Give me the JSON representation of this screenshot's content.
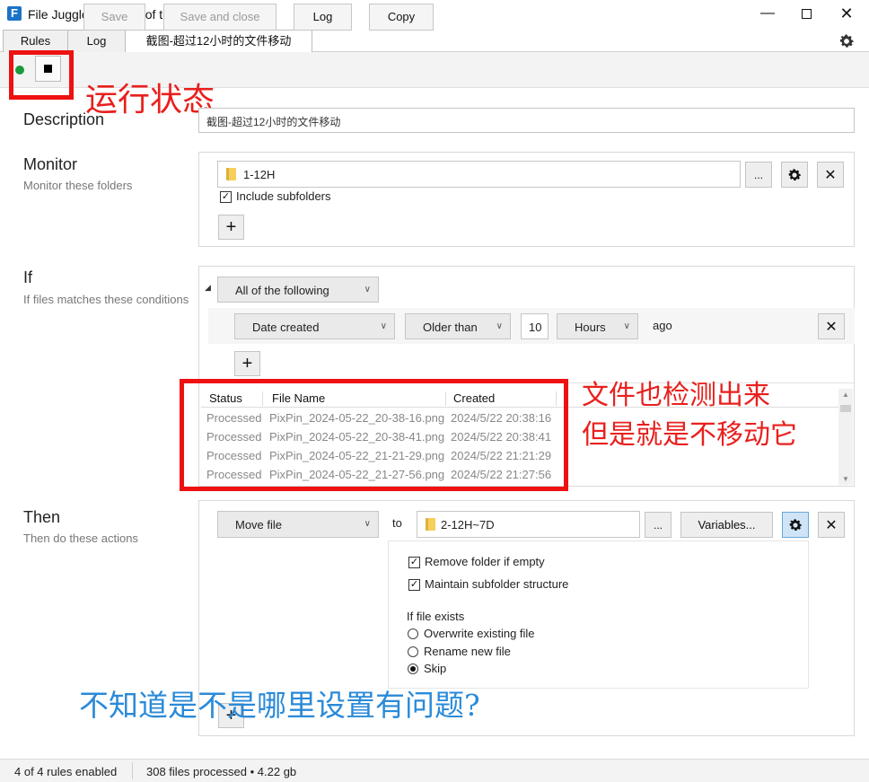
{
  "window": {
    "title": "File Juggler - day 38 of trial period",
    "icon_letter": "F"
  },
  "tabs": [
    {
      "label": "Rules"
    },
    {
      "label": "Log"
    },
    {
      "label": "截图-超过12小时的文件移动"
    }
  ],
  "toolbar": {
    "save": "Save",
    "save_close": "Save and close",
    "log": "Log",
    "copy": "Copy"
  },
  "description": {
    "title": "Description",
    "value": "截图-超过12小时的文件移动"
  },
  "monitor": {
    "title": "Monitor",
    "subtitle": "Monitor these folders",
    "folder": "1-12H",
    "browse": "...",
    "include_subfolders": "Include subfolders",
    "include_checked": true
  },
  "conditions": {
    "title": "If",
    "subtitle": "If files matches these conditions",
    "mode": "All of the following",
    "field": "Date created",
    "operator": "Older than",
    "amount": "10",
    "unit": "Hours",
    "suffix": "ago"
  },
  "matches": {
    "headers": [
      "Status",
      "File Name",
      "Created"
    ],
    "rows": [
      {
        "status": "Processed",
        "name": "PixPin_2024-05-22_20-38-16.png",
        "created": "2024/5/22 20:38:16"
      },
      {
        "status": "Processed",
        "name": "PixPin_2024-05-22_20-38-41.png",
        "created": "2024/5/22 20:38:41"
      },
      {
        "status": "Processed",
        "name": "PixPin_2024-05-22_21-21-29.png",
        "created": "2024/5/22 21:21:29"
      },
      {
        "status": "Processed",
        "name": "PixPin_2024-05-22_21-27-56.png",
        "created": "2024/5/22 21:27:56"
      }
    ]
  },
  "actions": {
    "title": "Then",
    "subtitle": "Then do these actions",
    "action": "Move file",
    "to": "to",
    "destination": "2-12H~7D",
    "browse": "...",
    "variables": "Variables...",
    "remove_folder": "Remove folder if empty",
    "maintain_structure": "Maintain subfolder structure",
    "if_exists": "If file exists",
    "opt_overwrite": "Overwrite existing file",
    "opt_rename": "Rename new file",
    "opt_skip": "Skip",
    "selected_option": "Skip"
  },
  "plus": "+",
  "statusbar": {
    "rules": "4 of 4 rules enabled",
    "processed": "308 files processed • 4.22 gb"
  },
  "annotations": {
    "run_state": "运行状态",
    "detected_line1": "文件也检测出来",
    "detected_line2": "但是就是不移动它",
    "question": "不知道是不是哪里设置有问题?"
  },
  "colors": {
    "annotation_red": "#ee1111",
    "annotation_blue": "#2a8ad8",
    "running_dot": "#1a9a3c",
    "app_icon": "#1a73c8"
  }
}
